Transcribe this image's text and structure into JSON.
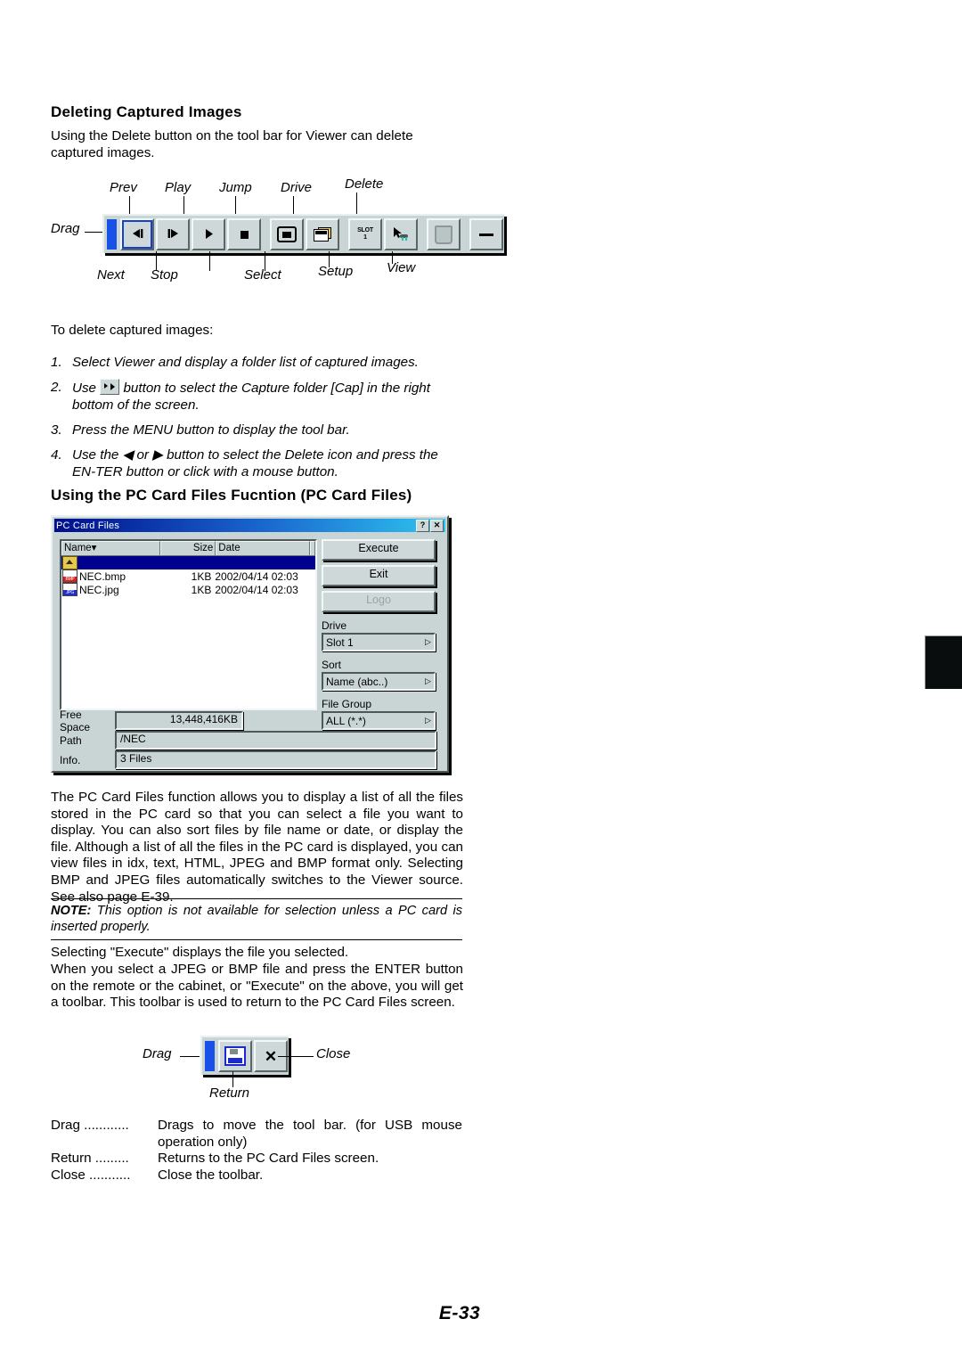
{
  "page": {
    "footer_label": "E-33"
  },
  "section1": {
    "heading": "Deleting Captured Images",
    "intro": "Using the Delete button on the tool bar for Viewer can delete captured images.",
    "lead_in": "To delete captured images:",
    "steps": [
      {
        "num": "1.",
        "text": "Select Viewer and display a folder list of captured images."
      },
      {
        "num": "2.",
        "pre": "Use",
        "post": "button to select the Capture folder [Cap] in the right bottom of the screen."
      },
      {
        "num": "3.",
        "text": "Press the MENU button to display the tool bar."
      },
      {
        "num": "4.",
        "text": "Use the ◀ or ▶ button to select the Delete icon and press the EN-TER button or click with a mouse button."
      }
    ]
  },
  "viewer_toolbar": {
    "labels_top": [
      "Prev",
      "Play",
      "Jump",
      "Drive",
      "Delete"
    ],
    "labels_bottom": [
      "Next",
      "Stop",
      "Select",
      "Setup",
      "View"
    ],
    "drag_label": "Drag",
    "buttons": [
      {
        "name": "prev",
        "glyph": "prev-icon"
      },
      {
        "name": "next",
        "glyph": "next-icon"
      },
      {
        "name": "play",
        "glyph": "play-icon"
      },
      {
        "name": "stop",
        "glyph": "stop-icon"
      },
      {
        "name": "jump",
        "glyph": "jump-screen-icon"
      },
      {
        "name": "select",
        "glyph": "select-folders-icon"
      },
      {
        "name": "drive",
        "glyph": "slot-icon",
        "line1": "SLOT",
        "line2": "1"
      },
      {
        "name": "setup",
        "glyph": "setup-cursor-icon"
      },
      {
        "name": "delete",
        "glyph": "trash-icon"
      },
      {
        "name": "view",
        "glyph": "minimize-dash-icon"
      }
    ]
  },
  "section2": {
    "heading": "Using the PC Card Files Fucntion (PC Card Files)",
    "paragraph": "The PC Card Files function allows you to display a list of all the files stored in the PC card so that you can select a file you want to display. You can also sort files by file name or date, or display the file. Although a list of all the files in the PC card is displayed, you can view files in idx, text, HTML, JPEG and BMP format only. Selecting BMP and JPEG files automatically switches to the Viewer source. See also page E-39.",
    "note_prefix": "NOTE:",
    "note_text": "This option is not available for selection unless a PC card is inserted properly.",
    "paragraph2_line1": "Selecting \"Execute\" displays the file you selected.",
    "paragraph2_rest": "When you select a JPEG or BMP file and press the ENTER button on the remote or the cabinet, or \"Execute\" on the above, you will get a toolbar. This toolbar is used to return to the PC Card Files screen."
  },
  "dialog": {
    "title": "PC Card Files",
    "help_button": "?",
    "close_button": "✕",
    "columns": [
      "Name▾",
      "Size",
      "Date"
    ],
    "rows": [
      {
        "icon": "folder-up-icon",
        "name": "",
        "size": "",
        "date": "",
        "selected": true
      },
      {
        "icon": "bmp-file-icon",
        "name": "NEC.bmp",
        "size": "1KB",
        "date": "2002/04/14 02:03",
        "selected": false
      },
      {
        "icon": "jpg-file-icon",
        "name": "NEC.jpg",
        "size": "1KB",
        "date": "2002/04/14 02:03",
        "selected": false
      }
    ],
    "buttons": [
      {
        "label": "Execute",
        "disabled": false
      },
      {
        "label": "Exit",
        "disabled": false
      },
      {
        "label": "Logo",
        "disabled": true
      }
    ],
    "selects": [
      {
        "label": "Drive",
        "value": "Slot 1"
      },
      {
        "label": "Sort",
        "value": "Name (abc..)"
      },
      {
        "label": "File Group",
        "value": "ALL (*.*)"
      }
    ],
    "fields": [
      {
        "label": "Free Space",
        "value": "13,448,416KB"
      },
      {
        "label": "Path",
        "value": "/NEC"
      },
      {
        "label": "Info.",
        "value": "3 Files"
      }
    ]
  },
  "return_toolbar": {
    "drag_label": "Drag",
    "return_label": "Return",
    "close_label": "Close",
    "buttons": [
      {
        "name": "return",
        "glyph": "return-icon"
      },
      {
        "name": "close",
        "glyph": "close-x-icon"
      }
    ]
  },
  "definitions": [
    {
      "term": "Drag ............",
      "desc": "Drags to move the tool bar. (for USB mouse operation only)"
    },
    {
      "term": "Return .........",
      "desc": "Returns to the PC Card Files screen."
    },
    {
      "term": "Close ...........",
      "desc": "Close the toolbar."
    }
  ]
}
